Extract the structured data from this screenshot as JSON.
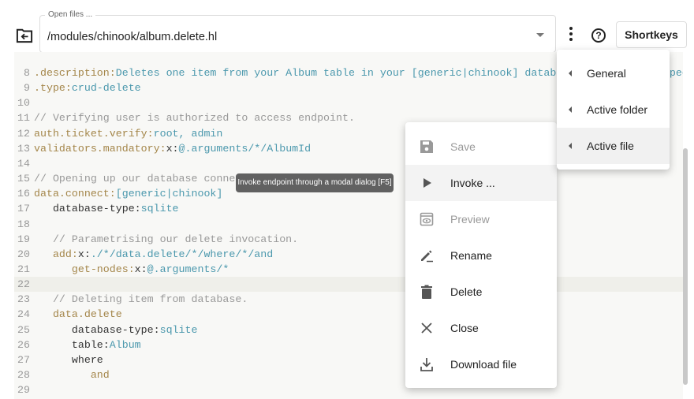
{
  "header": {
    "open_files_label": "Open files ...",
    "open_file_value": "/modules/chinook/album.delete.hl",
    "shortkeys_label": "Shortkeys",
    "help_icon": "?"
  },
  "editor": {
    "lines": [
      {
        "n": "8",
        "parts": [
          [
            "k",
            ".description:"
          ],
          [
            "v",
            "Deletes one item from your Album table in your [generic|chinook] database matching the specified"
          ]
        ]
      },
      {
        "n": "9",
        "parts": [
          [
            "k",
            ".type:"
          ],
          [
            "v",
            "crud-delete"
          ]
        ]
      },
      {
        "n": "10",
        "parts": []
      },
      {
        "n": "11",
        "parts": [
          [
            "c",
            "// Verifying user is authorized to access endpoint."
          ]
        ]
      },
      {
        "n": "12",
        "parts": [
          [
            "k",
            "auth.ticket.verify:"
          ],
          [
            "v",
            "root, admin"
          ]
        ]
      },
      {
        "n": "13",
        "parts": [
          [
            "k",
            "validators.mandatory:"
          ],
          [
            "p",
            "x:"
          ],
          [
            "v",
            "@.arguments/*/AlbumId"
          ]
        ]
      },
      {
        "n": "14",
        "parts": []
      },
      {
        "n": "15",
        "parts": [
          [
            "c",
            "// Opening up our database connection."
          ]
        ]
      },
      {
        "n": "16",
        "parts": [
          [
            "k",
            "data.connect:"
          ],
          [
            "v",
            "[generic|chinook]"
          ]
        ]
      },
      {
        "n": "17",
        "parts": [
          [
            "p",
            "   database-type:"
          ],
          [
            "v",
            "sqlite"
          ]
        ]
      },
      {
        "n": "18",
        "parts": []
      },
      {
        "n": "19",
        "parts": [
          [
            "c",
            "   // Parametrising our delete invocation."
          ]
        ]
      },
      {
        "n": "20",
        "parts": [
          [
            "k",
            "   add:"
          ],
          [
            "p",
            "x:"
          ],
          [
            "v",
            "./*/data.delete/*/where/*/and"
          ]
        ]
      },
      {
        "n": "21",
        "parts": [
          [
            "k",
            "      get-nodes:"
          ],
          [
            "p",
            "x:"
          ],
          [
            "v",
            "@.arguments/*"
          ]
        ]
      },
      {
        "n": "22",
        "parts": [],
        "active": true
      },
      {
        "n": "23",
        "parts": [
          [
            "c",
            "   // Deleting item from database."
          ]
        ]
      },
      {
        "n": "24",
        "parts": [
          [
            "k",
            "   data.delete"
          ]
        ]
      },
      {
        "n": "25",
        "parts": [
          [
            "p",
            "      database-type:"
          ],
          [
            "v",
            "sqlite"
          ]
        ]
      },
      {
        "n": "26",
        "parts": [
          [
            "p",
            "      table:"
          ],
          [
            "v",
            "Album"
          ]
        ]
      },
      {
        "n": "27",
        "parts": [
          [
            "p",
            "      where"
          ]
        ]
      },
      {
        "n": "28",
        "parts": [
          [
            "k",
            "         and"
          ]
        ]
      },
      {
        "n": "29",
        "parts": []
      }
    ]
  },
  "menu": {
    "items": [
      {
        "label": "Save",
        "icon": "save-icon",
        "disabled": true
      },
      {
        "label": "Invoke ...",
        "icon": "play-icon",
        "hover": true
      },
      {
        "label": "Preview",
        "icon": "preview-icon",
        "disabled": true
      },
      {
        "label": "Rename",
        "icon": "rename-icon"
      },
      {
        "label": "Delete",
        "icon": "delete-icon"
      },
      {
        "label": "Close",
        "icon": "close-icon"
      },
      {
        "label": "Download file",
        "icon": "download-icon"
      }
    ]
  },
  "submenu": {
    "items": [
      {
        "label": "General"
      },
      {
        "label": "Active folder"
      },
      {
        "label": "Active file",
        "active": true
      }
    ]
  },
  "tooltip": "Invoke endpoint through a modal dialog [F5]"
}
